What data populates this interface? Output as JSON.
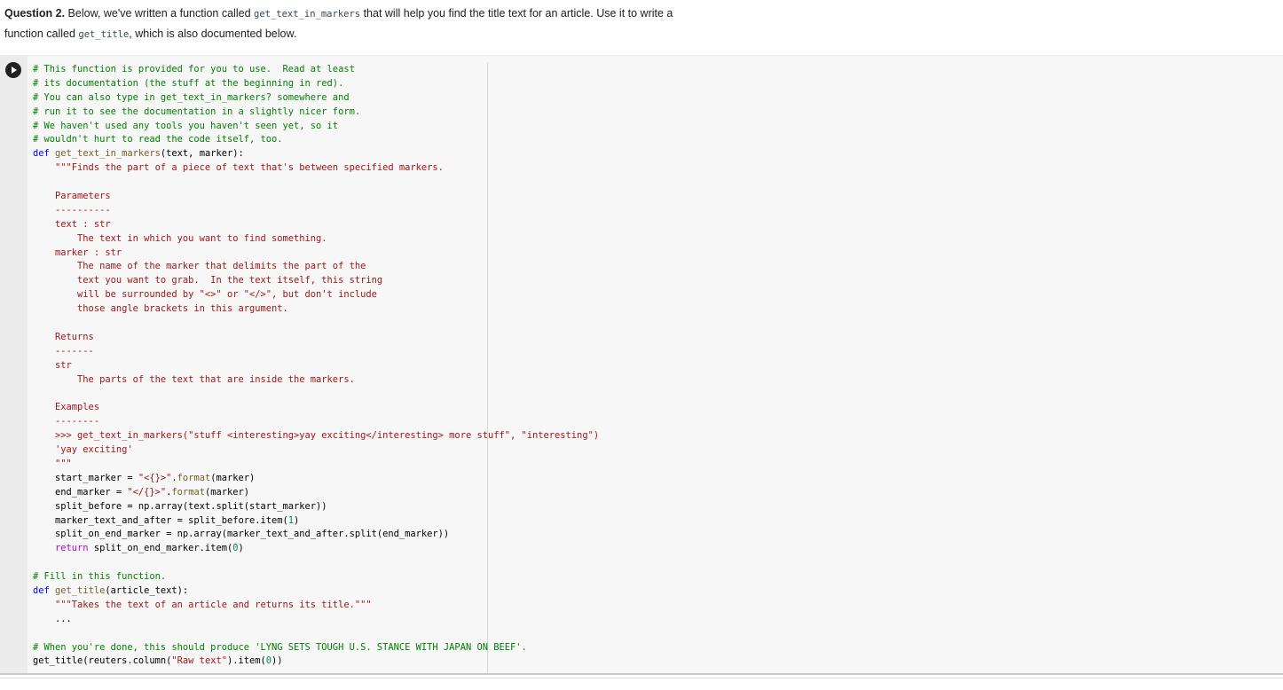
{
  "question": {
    "label": "Question 2.",
    "part1": " Below, we've written a function called ",
    "code1": "get_text_in_markers",
    "part2": " that will help you find the title text for an article. Use it to write a",
    "part3": "function called ",
    "code2": "get_title",
    "part4": ", which is also documented below."
  },
  "cell": {
    "run_icon": "play-icon",
    "lines": [
      [
        [
          "c",
          "# This function is provided for you to use.  Read at least"
        ]
      ],
      [
        [
          "c",
          "# its documentation (the stuff at the beginning in red)."
        ]
      ],
      [
        [
          "c",
          "# You can also type in get_text_in_markers? somewhere and"
        ]
      ],
      [
        [
          "c",
          "# run it to see the documentation in a slightly nicer form."
        ]
      ],
      [
        [
          "c",
          "# We haven't used any tools you haven't seen yet, so it"
        ]
      ],
      [
        [
          "c",
          "# wouldn't hurt to read the code itself, too."
        ]
      ],
      [
        [
          "k",
          "def"
        ],
        [
          "f",
          " get_text_in_markers"
        ],
        [
          "p",
          "(text, marker):"
        ]
      ],
      [
        [
          "s",
          "    \"\"\"Finds the part of a piece of text that's between specified markers."
        ]
      ],
      [
        [
          "s",
          ""
        ]
      ],
      [
        [
          "s",
          "    Parameters"
        ]
      ],
      [
        [
          "s",
          "    ----------"
        ]
      ],
      [
        [
          "s",
          "    text : str"
        ]
      ],
      [
        [
          "s",
          "        The text in which you want to find something."
        ]
      ],
      [
        [
          "s",
          "    marker : str"
        ]
      ],
      [
        [
          "s",
          "        The name of the marker that delimits the part of the"
        ]
      ],
      [
        [
          "s",
          "        text you want to grab.  In the text itself, this string"
        ]
      ],
      [
        [
          "s",
          "        will be surrounded by \"<>\" or \"</>\", but don't include"
        ]
      ],
      [
        [
          "s",
          "        those angle brackets in this argument."
        ]
      ],
      [
        [
          "s",
          ""
        ]
      ],
      [
        [
          "s",
          "    Returns"
        ]
      ],
      [
        [
          "s",
          "    -------"
        ]
      ],
      [
        [
          "s",
          "    str"
        ]
      ],
      [
        [
          "s",
          "        The parts of the text that are inside the markers."
        ]
      ],
      [
        [
          "s",
          ""
        ]
      ],
      [
        [
          "s",
          "    Examples"
        ]
      ],
      [
        [
          "s",
          "    --------"
        ]
      ],
      [
        [
          "s",
          "    >>> get_text_in_markers(\"stuff <interesting>yay exciting</interesting> more stuff\", \"interesting\")"
        ]
      ],
      [
        [
          "s",
          "    'yay exciting'"
        ]
      ],
      [
        [
          "s",
          "    \"\"\""
        ]
      ],
      [
        [
          "p",
          "    start_marker = "
        ],
        [
          "s",
          "\"<{}>\""
        ],
        [
          "p",
          "."
        ],
        [
          "f",
          "format"
        ],
        [
          "p",
          "(marker)"
        ]
      ],
      [
        [
          "p",
          "    end_marker = "
        ],
        [
          "s",
          "\"</{}>\""
        ],
        [
          "p",
          "."
        ],
        [
          "f",
          "format"
        ],
        [
          "p",
          "(marker)"
        ]
      ],
      [
        [
          "p",
          "    split_before = np.array(text.split(start_marker))"
        ]
      ],
      [
        [
          "p",
          "    marker_text_and_after = split_before.item("
        ],
        [
          "n",
          "1"
        ],
        [
          "p",
          ")"
        ]
      ],
      [
        [
          "p",
          "    split_on_end_marker = np.array(marker_text_and_after.split(end_marker))"
        ]
      ],
      [
        [
          "r",
          "    return"
        ],
        [
          "p",
          " split_on_end_marker.item("
        ],
        [
          "n",
          "0"
        ],
        [
          "p",
          ")"
        ]
      ],
      [
        [
          "p",
          ""
        ]
      ],
      [
        [
          "c",
          "# Fill in this function."
        ]
      ],
      [
        [
          "k",
          "def"
        ],
        [
          "f",
          " get_title"
        ],
        [
          "p",
          "(article_text):"
        ]
      ],
      [
        [
          "s",
          "    \"\"\"Takes the text of an article and returns its title.\"\"\""
        ]
      ],
      [
        [
          "p",
          "    ..."
        ]
      ],
      [
        [
          "p",
          ""
        ]
      ],
      [
        [
          "c",
          "# When you're done, this should produce 'LYNG SETS TOUGH U.S. STANCE WITH JAPAN ON BEEF'."
        ]
      ],
      [
        [
          "p",
          "get_title(reuters.column("
        ],
        [
          "s",
          "\"Raw text\""
        ],
        [
          "p",
          ").item("
        ],
        [
          "n",
          "0"
        ],
        [
          "p",
          "))"
        ]
      ]
    ]
  }
}
